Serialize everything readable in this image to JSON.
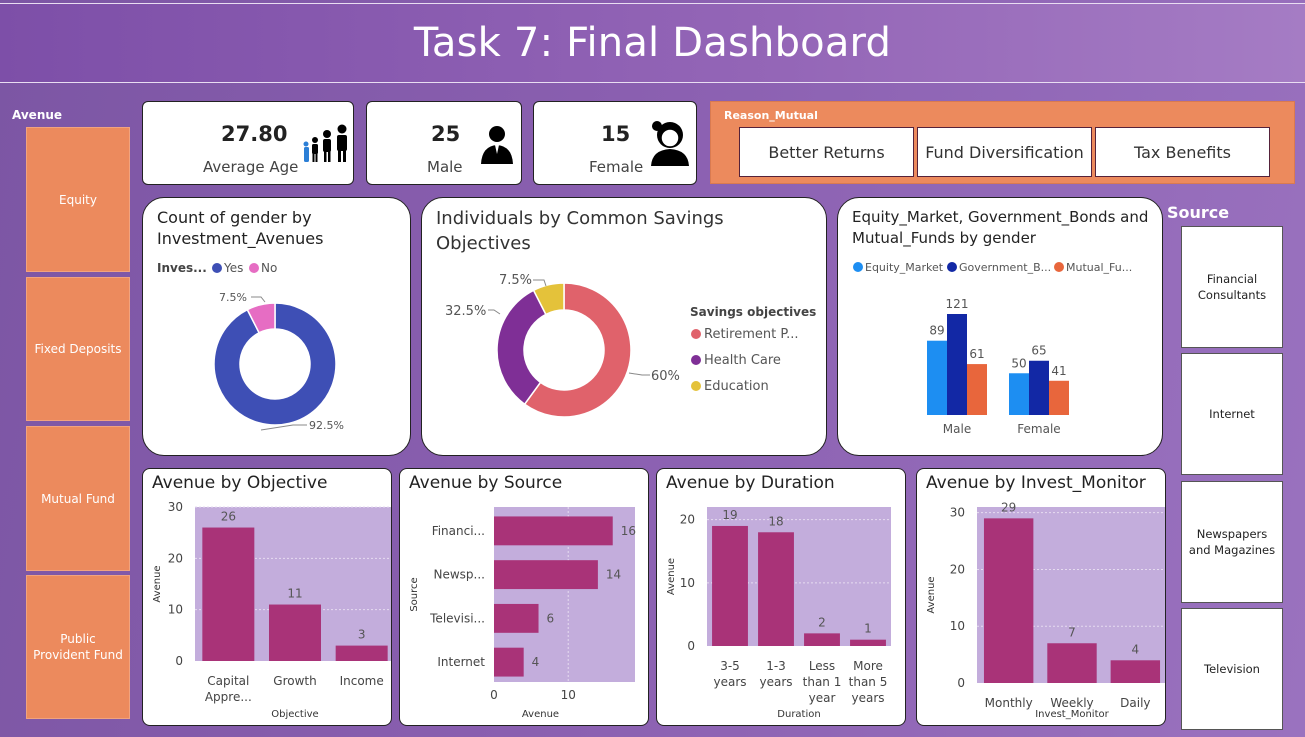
{
  "title": "Task 7: Final Dashboard",
  "avenue_slicer": {
    "label": "Avenue",
    "items": [
      "Equity",
      "Fixed Deposits",
      "Mutual Fund",
      "Public\nProvident Fund"
    ]
  },
  "kpis": [
    {
      "value": "27.80",
      "label": "Average Age",
      "icon": "family-icon"
    },
    {
      "value": "25",
      "label": "Male",
      "icon": "man-icon"
    },
    {
      "value": "15",
      "label": "Female",
      "icon": "woman-icon"
    }
  ],
  "reason_slicer": {
    "label": "Reason_Mutual",
    "items": [
      "Better Returns",
      "Fund Diversification",
      "Tax Benefits"
    ]
  },
  "source_slicer": {
    "label": "Source",
    "items": [
      "Financial\nConsultants",
      "Internet",
      "Newspapers\nand Magazines",
      "Television"
    ]
  },
  "colors": {
    "bar_purple": "#a93378",
    "plot_bg": "#c3addc",
    "slicer_orange": "#ec8a5d",
    "donut_blue": "#3e4fb5",
    "donut_pink": "#e66dc3",
    "retire": "#e0626b",
    "health": "#7f2f96",
    "education": "#e4c23a",
    "equity": "#1d8ef2",
    "govt": "#1228a5",
    "mutual": "#e8663c"
  },
  "chart_data": [
    {
      "id": "gender-investment",
      "type": "pie",
      "title": "Count of gender by Investment_Avenues",
      "legend_title": "Inves...",
      "legend": [
        "Yes",
        "No"
      ],
      "values": [
        92.5,
        7.5
      ],
      "labels": [
        "92.5%",
        "7.5%"
      ]
    },
    {
      "id": "savings-objectives",
      "type": "pie",
      "title": "Individuals by Common Savings Objectives",
      "legend_title": "Savings objectives",
      "legend": [
        "Retirement P...",
        "Health Care",
        "Education"
      ],
      "values": [
        60,
        32.5,
        7.5
      ],
      "labels": [
        "60%",
        "32.5%",
        "7.5%"
      ]
    },
    {
      "id": "instruments-gender",
      "type": "bar",
      "title": "Equity_Market, Government_Bonds and Mutual_Funds by gender",
      "legend": [
        "Equity_Market",
        "Government_B...",
        "Mutual_Fu..."
      ],
      "categories": [
        "Male",
        "Female"
      ],
      "series": [
        {
          "name": "Equity_Market",
          "values": [
            89,
            50
          ]
        },
        {
          "name": "Government_B...",
          "values": [
            121,
            65
          ]
        },
        {
          "name": "Mutual_Fu...",
          "values": [
            61,
            41
          ]
        }
      ],
      "ylim": [
        0,
        121
      ]
    },
    {
      "id": "avenue-objective",
      "type": "bar",
      "title": "Avenue by Objective",
      "xlabel": "Objective",
      "ylabel": "Avenue",
      "categories": [
        "Capital\nAppre...",
        "Growth",
        "Income"
      ],
      "values": [
        26,
        11,
        3
      ],
      "ylim": [
        0,
        30
      ],
      "yticks": [
        "0",
        "10",
        "20",
        "30"
      ],
      "grid": true
    },
    {
      "id": "avenue-source",
      "type": "bar",
      "orientation": "horizontal",
      "title": "Avenue by Source",
      "xlabel": "Avenue",
      "ylabel": "Source",
      "categories": [
        "Financi...",
        "Newsp...",
        "Televisi...",
        "Internet"
      ],
      "values": [
        16,
        14,
        6,
        4
      ],
      "xlim": [
        0,
        19
      ],
      "xticks": [
        "0",
        "10"
      ],
      "grid": true
    },
    {
      "id": "avenue-duration",
      "type": "bar",
      "title": "Avenue by Duration",
      "xlabel": "Duration",
      "ylabel": "Avenue",
      "categories": [
        "3-5\nyears",
        "1-3\nyears",
        "Less\nthan 1\nyear",
        "More\nthan 5\nyears"
      ],
      "values": [
        19,
        18,
        2,
        1
      ],
      "ylim": [
        0,
        22
      ],
      "yticks": [
        "0",
        "10",
        "20"
      ],
      "grid": true
    },
    {
      "id": "avenue-monitor",
      "type": "bar",
      "title": "Avenue by Invest_Monitor",
      "xlabel": "Invest_Monitor",
      "ylabel": "Avenue",
      "categories": [
        "Monthly",
        "Weekly",
        "Daily"
      ],
      "values": [
        29,
        7,
        4
      ],
      "ylim": [
        0,
        31
      ],
      "yticks": [
        "0",
        "10",
        "20",
        "30"
      ],
      "grid": true
    }
  ]
}
